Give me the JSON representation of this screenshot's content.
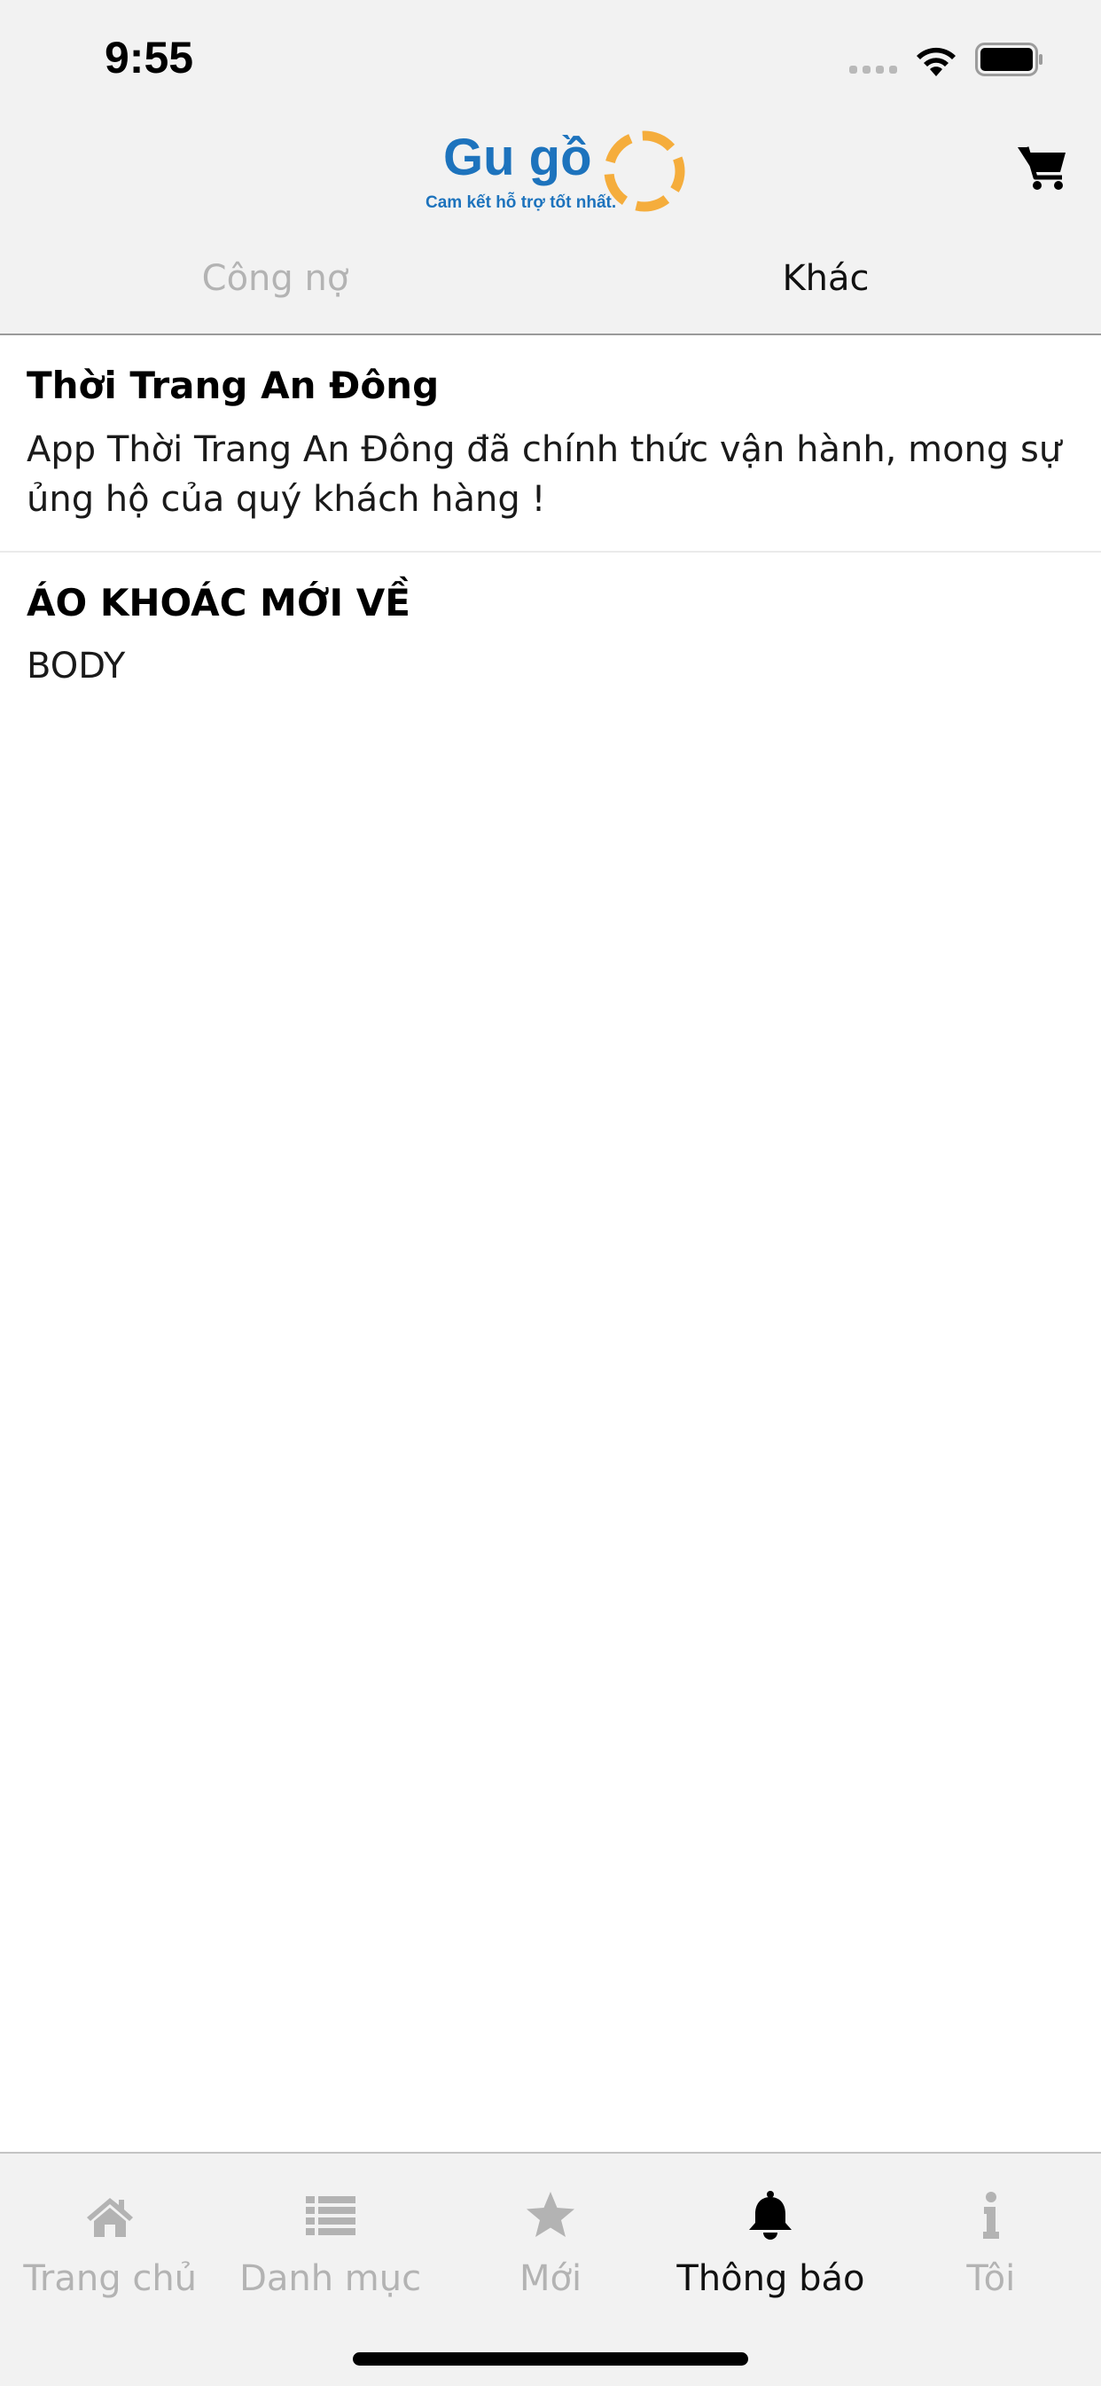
{
  "status_bar": {
    "time": "9:55"
  },
  "header": {
    "logo": {
      "name": "Gu gồ",
      "tagline": "Cam kết hỗ trợ tốt nhất.",
      "colors": {
        "text": "#1d73bd",
        "ring": "#f5ad3c"
      }
    },
    "cart_icon": "cart-icon"
  },
  "tabs": [
    {
      "label": "Công nợ",
      "active": false
    },
    {
      "label": "Khác",
      "active": true
    }
  ],
  "notifications": [
    {
      "title": "Thời Trang An Đông",
      "body": "App Thời Trang An Đông đã chính thức vận hành, mong sự ủng hộ của quý khách hàng !"
    },
    {
      "title": "ÁO KHOÁC MỚI VỀ",
      "body": "BODY"
    }
  ],
  "tabbar": {
    "items": [
      {
        "label": "Trang chủ",
        "icon": "home-icon",
        "active": false
      },
      {
        "label": "Danh mục",
        "icon": "list-icon",
        "active": false
      },
      {
        "label": "Mới",
        "icon": "star-icon",
        "active": false
      },
      {
        "label": "Thông báo",
        "icon": "bell-icon",
        "active": true
      },
      {
        "label": "Tôi",
        "icon": "info-icon",
        "active": false
      }
    ],
    "colors": {
      "active": "#000000",
      "inactive": "#b3b3b3"
    }
  }
}
